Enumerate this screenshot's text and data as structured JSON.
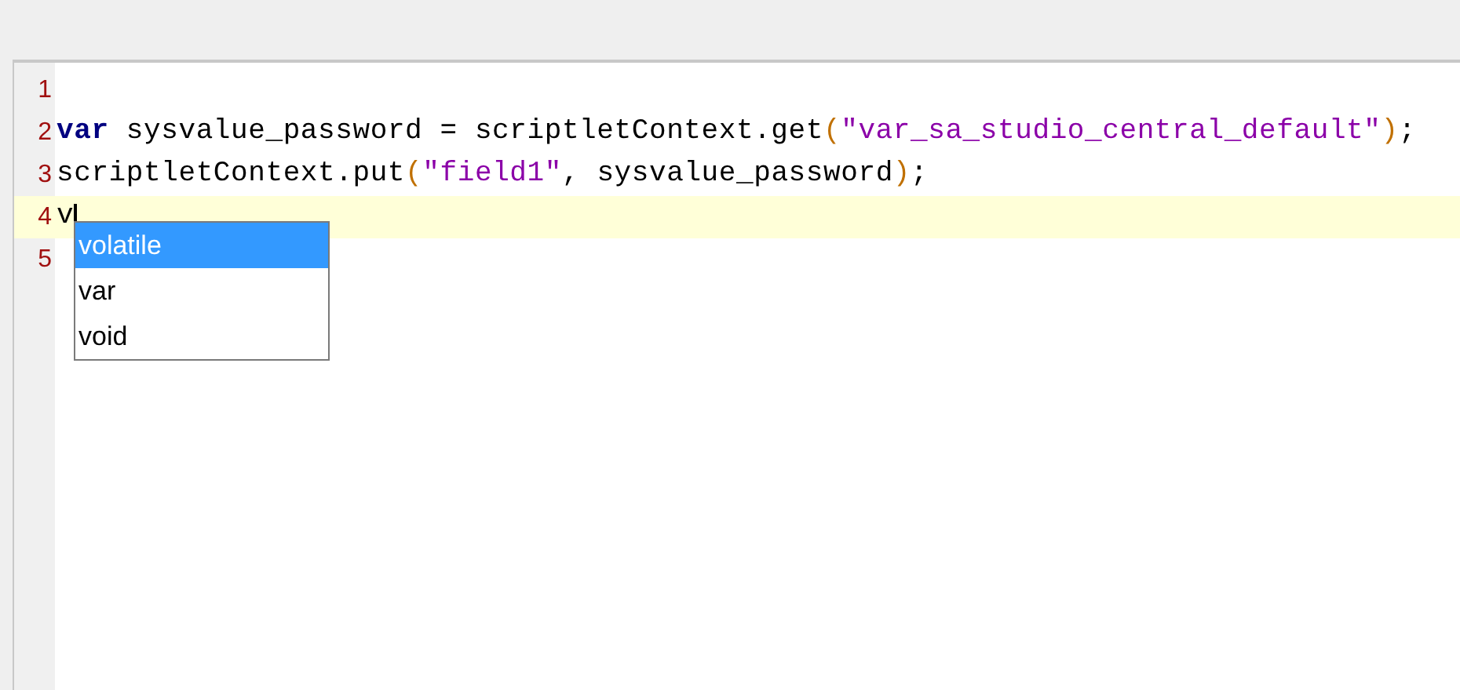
{
  "editor": {
    "lines": [
      {
        "number": "1",
        "current": false
      },
      {
        "number": "2",
        "current": false,
        "tokens": [
          {
            "kind": "keyword",
            "text": "var"
          },
          {
            "kind": "plain",
            "text": " sysvalue_password = scriptletContext.get"
          },
          {
            "kind": "punct",
            "text": "("
          },
          {
            "kind": "string",
            "text": "\"var_sa_studio_central_default\""
          },
          {
            "kind": "punct",
            "text": ")"
          },
          {
            "kind": "plain",
            "text": ";"
          }
        ]
      },
      {
        "number": "3",
        "current": false,
        "tokens": [
          {
            "kind": "plain",
            "text": "scriptletContext.put"
          },
          {
            "kind": "punct",
            "text": "("
          },
          {
            "kind": "string",
            "text": "\"field1\""
          },
          {
            "kind": "plain",
            "text": ", sysvalue_password"
          },
          {
            "kind": "punct",
            "text": ")"
          },
          {
            "kind": "plain",
            "text": ";"
          }
        ]
      },
      {
        "number": "4",
        "current": true,
        "tokens": [
          {
            "kind": "plain",
            "text": "v"
          }
        ]
      },
      {
        "number": "5",
        "current": false
      }
    ]
  },
  "autocomplete": [
    {
      "label": "volatile",
      "selected": true
    },
    {
      "label": "var",
      "selected": false
    },
    {
      "label": "void",
      "selected": false
    }
  ]
}
